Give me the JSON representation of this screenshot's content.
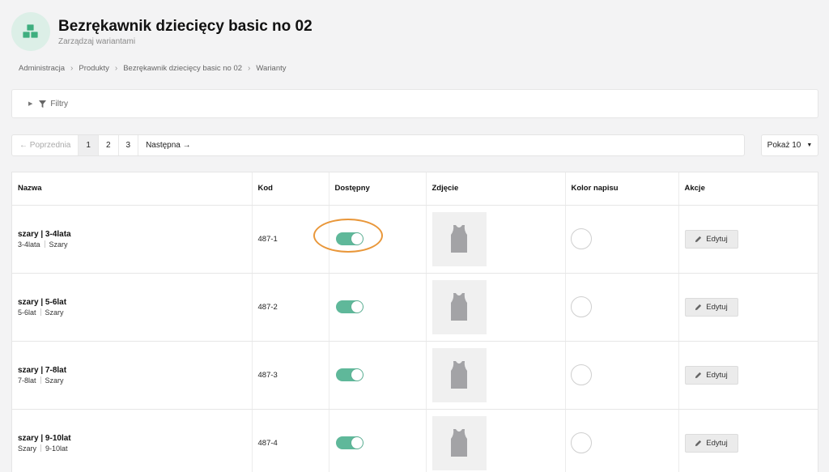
{
  "header": {
    "title": "Bezrękawnik dziecięcy basic no 02",
    "subtitle": "Zarządzaj wariantami",
    "logo_icon": "cubes-icon",
    "accent": "#5fb89a"
  },
  "breadcrumb": [
    "Administracja",
    "Produkty",
    "Bezrękawnik dziecięcy basic no 02",
    "Warianty"
  ],
  "filters": {
    "label": "Filtry"
  },
  "pagination": {
    "prev": "← Poprzednia",
    "pages": [
      "1",
      "2",
      "3"
    ],
    "current": "1",
    "next": "Następna →"
  },
  "show": {
    "label": "Pokaż 10"
  },
  "table": {
    "columns": [
      "Nazwa",
      "Kod",
      "Dostępny",
      "Zdjęcie",
      "Kolor napisu",
      "Akcje"
    ],
    "rows": [
      {
        "title": "szary | 3-4lata",
        "sub1": "3-4lata",
        "sub2": "Szary",
        "code": "487-1",
        "available": true,
        "edit": "Edytuj"
      },
      {
        "title": "szary | 5-6lat",
        "sub1": "5-6lat",
        "sub2": "Szary",
        "code": "487-2",
        "available": true,
        "edit": "Edytuj"
      },
      {
        "title": "szary | 7-8lat",
        "sub1": "7-8lat",
        "sub2": "Szary",
        "code": "487-3",
        "available": true,
        "edit": "Edytuj"
      },
      {
        "title": "szary | 9-10lat",
        "sub1": "Szary",
        "sub2": "9-10lat",
        "code": "487-4",
        "available": true,
        "edit": "Edytuj"
      }
    ]
  },
  "annotation_color": "#e9973a"
}
